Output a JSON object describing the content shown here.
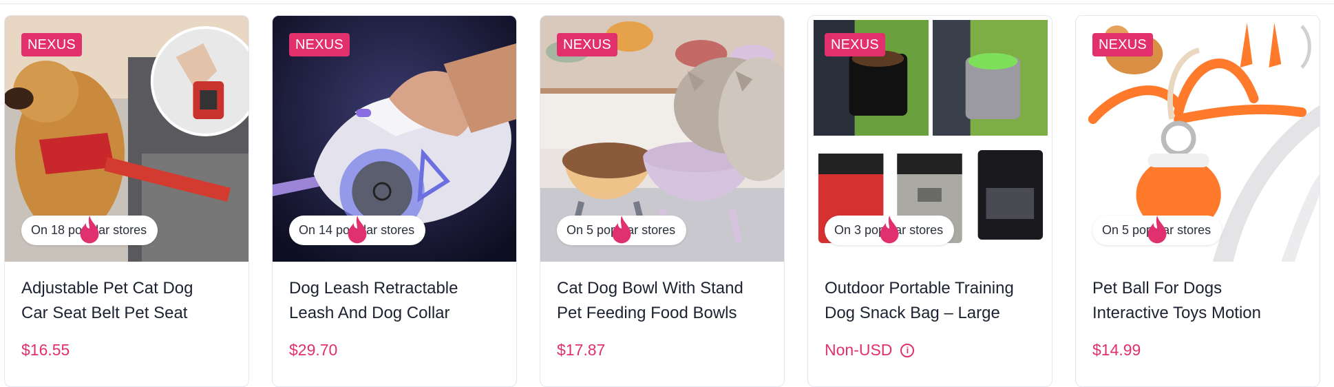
{
  "colors": {
    "brand": "#e1306c",
    "price": "#e0306d"
  },
  "products": [
    {
      "badge": "NEXUS",
      "stores_text": "On 18 popular stores",
      "title_line1": "Adjustable Pet Cat Dog",
      "title_line2": "Car Seat Belt Pet Seat",
      "price": "$16.55"
    },
    {
      "badge": "NEXUS",
      "stores_text": "On 14 popular stores",
      "title_line1": "Dog Leash Retractable",
      "title_line2": "Leash And Dog Collar",
      "price": "$29.70"
    },
    {
      "badge": "NEXUS",
      "stores_text": "On 5 popular stores",
      "title_line1": "Cat Dog Bowl With Stand",
      "title_line2": "Pet Feeding Food Bowls",
      "price": "$17.87"
    },
    {
      "badge": "NEXUS",
      "stores_text": "On 3 popular stores",
      "title_line1": "Outdoor Portable Training",
      "title_line2": "Dog Snack Bag – Large",
      "price": "Non-USD",
      "price_info_icon": "info-icon"
    },
    {
      "badge": "NEXUS",
      "stores_text": "On 5 popular stores",
      "title_line1": "Pet Ball For Dogs",
      "title_line2": "Interactive Toys Motion",
      "price": "$14.99"
    }
  ]
}
